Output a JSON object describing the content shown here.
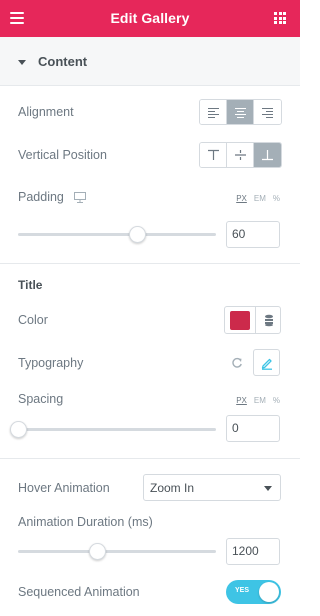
{
  "header": {
    "title": "Edit Gallery",
    "menu_icon": "hamburger-icon",
    "apps_icon": "grid-icon"
  },
  "section": {
    "label": "Content"
  },
  "alignment": {
    "label": "Alignment",
    "options": [
      "left",
      "center",
      "right"
    ],
    "selected": "center"
  },
  "vertical_position": {
    "label": "Vertical Position",
    "options": [
      "top",
      "middle",
      "bottom"
    ],
    "selected": "bottom"
  },
  "padding": {
    "label": "Padding",
    "device_icon": "desktop-icon",
    "units": [
      "PX",
      "EM",
      "%"
    ],
    "selected_unit": "PX",
    "value": "60",
    "slider_fraction": 0.6
  },
  "title_section": {
    "label": "Title"
  },
  "color": {
    "label": "Color",
    "value": "#cc2a4b",
    "global_icon": "database-icon"
  },
  "typography": {
    "label": "Typography",
    "reset_icon": "reset-icon",
    "edit_icon": "pencil-icon"
  },
  "spacing": {
    "label": "Spacing",
    "units": [
      "PX",
      "EM",
      "%"
    ],
    "selected_unit": "PX",
    "value": "0",
    "slider_fraction": 0
  },
  "hover_animation": {
    "label": "Hover Animation",
    "value": "Zoom In"
  },
  "animation_duration": {
    "label": "Animation Duration (ms)",
    "value": "1200",
    "slider_fraction": 0.4
  },
  "sequenced_animation": {
    "label": "Sequenced Animation",
    "toggle_text": "YES",
    "on": true
  },
  "colors": {
    "brand": "#e6275a",
    "toggle_on": "#3ec4e5",
    "active_button": "#a4afb7"
  }
}
